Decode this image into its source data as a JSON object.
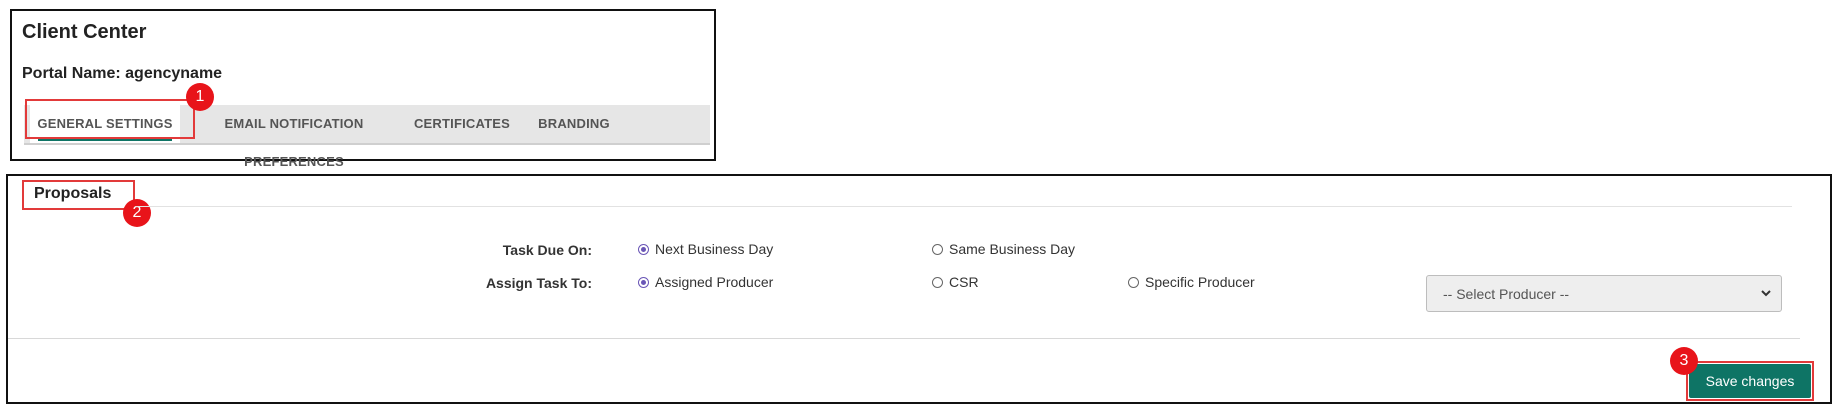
{
  "header": {
    "title": "Client Center",
    "portal_name": "Portal Name: agencyname"
  },
  "tabs": [
    {
      "label": "GENERAL SETTINGS",
      "active": true
    },
    {
      "label": "EMAIL NOTIFICATION PREFERENCES",
      "active": false
    },
    {
      "label": "CERTIFICATES",
      "active": false
    },
    {
      "label": "BRANDING",
      "active": false
    }
  ],
  "callouts": [
    "1",
    "2",
    "3"
  ],
  "proposals": {
    "section_title": "Proposals",
    "task_due_on": {
      "label": "Task Due On:",
      "options": [
        {
          "label": "Next Business Day",
          "checked": true
        },
        {
          "label": "Same Business Day",
          "checked": false
        }
      ]
    },
    "assign_task_to": {
      "label": "Assign Task To:",
      "options": [
        {
          "label": "Assigned Producer",
          "checked": true
        },
        {
          "label": "CSR",
          "checked": false
        },
        {
          "label": "Specific Producer",
          "checked": false
        }
      ]
    },
    "producer_select": {
      "value": "-- Select Producer --"
    }
  },
  "actions": {
    "save_label": "Save changes"
  },
  "colors": {
    "accent": "#0e7465",
    "highlight": "#e23a3a",
    "badge": "#e8141a",
    "radio": "#6a56b6"
  }
}
